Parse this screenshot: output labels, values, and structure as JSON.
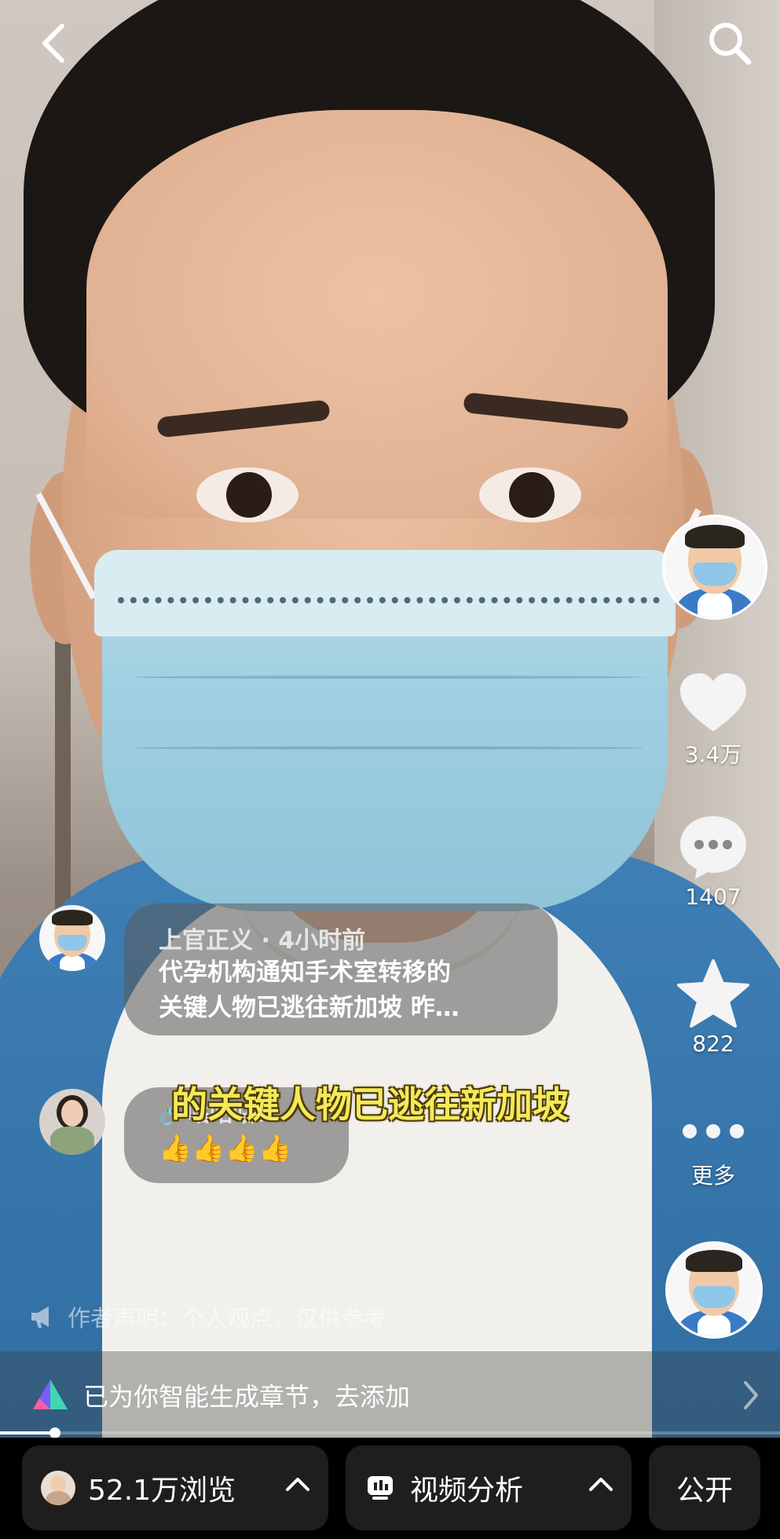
{
  "header": {
    "back_icon": "chevron-left-icon",
    "search_icon": "search-icon"
  },
  "rail": {
    "likes": "3.4万",
    "comments": "1407",
    "favorites": "822",
    "more": "更多"
  },
  "comments": [
    {
      "author": "上官正义 · 4小时前",
      "text_line1": "代孕机构通知手术室转移的",
      "text_line2": "关键人物已逃往新加坡 昨…"
    },
    {
      "author": "🔗咕咕咕：",
      "text": "👍👍👍👍"
    }
  ],
  "subtitle": "的关键人物已逃往新加坡",
  "statement": "作者声明：个人观点，仅供参考",
  "chapter_bar": {
    "label": "已为你智能生成章节，去添加"
  },
  "progress": {
    "fraction": 0.07
  },
  "bottom_bar": {
    "views": "52.1万浏览",
    "analysis": "视频分析",
    "visibility": "公开"
  },
  "colors": {
    "subtitle": "#f2ea5a",
    "bottom_bg": "#000000",
    "pill_bg": "#1e1e1e"
  }
}
